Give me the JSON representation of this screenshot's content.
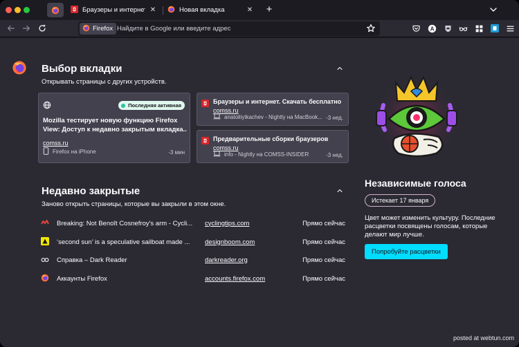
{
  "tabs": [
    {
      "title": "Браузеры и интернет. Скачать бесплатно",
      "close": "✕"
    },
    {
      "title": "Новая вкладка",
      "close": "✕"
    }
  ],
  "tabstrip": {
    "new_tab": "+"
  },
  "urlbar": {
    "identity_label": "Firefox",
    "placeholder": "Найдите в Google или введите адрес"
  },
  "toolbar": {
    "extension_badge": "A"
  },
  "tab_pickup": {
    "heading": "Выбор вкладки",
    "subheading": "Открывать страницы с других устройств.",
    "featured": {
      "badge": "Последняя активная",
      "title_line1": "Mozilla тестирует новую функцию Firefox",
      "title_line2": "View: Доступ к недавно закрытым вкладка...",
      "domain": "comss.ru",
      "device": "Firefox на iPhone",
      "time": "-3 мин"
    },
    "items": [
      {
        "title": "Браузеры и интернет. Скачать бесплатно",
        "domain": "comss.ru",
        "device": "anatoliiytkachev - Nightly на MacBook...",
        "time": "-3 нед."
      },
      {
        "title": "Предварительные сборки браузеров",
        "domain": "comss.ru",
        "device": "info - Nightly на COMSS-INSIDER",
        "time": "-3 нед."
      }
    ]
  },
  "recently_closed": {
    "heading": "Недавно закрытые",
    "subheading": "Заново открыть страницы, которые вы закрыли в этом окне.",
    "rows": [
      {
        "title": "Breaking: Not Benoît Cosnefroy's arm - Cycli...",
        "url": "cyclingtips.com",
        "time": "Прямо сейчас"
      },
      {
        "title": "‘second sun’ is a speculative sailboat made ...",
        "url": "designboom.com",
        "time": "Прямо сейчас"
      },
      {
        "title": "Справка – Dark Reader",
        "url": "darkreader.org",
        "time": "Прямо сейчас"
      },
      {
        "title": "Аккаунты Firefox",
        "url": "accounts.firefox.com",
        "time": "Прямо сейчас"
      }
    ]
  },
  "promo": {
    "title": "Независимые голоса",
    "badge": "Истекает 17 января",
    "text": "Цвет может изменить культуру. Последние расцветки посвящены голосам, которые делают мир лучше.",
    "button": "Попробуйте расцветки"
  },
  "watermark": "posted at webtun.com",
  "colors": {
    "accent": "#00ddff",
    "badge_bg": "#e0f9ee",
    "badge_dot": "#2ac3a2",
    "traffic_red": "#ff5f57",
    "traffic_yellow": "#febc2e",
    "traffic_green": "#28c840"
  },
  "icons": {
    "pinned_tab": "firefox-logo-icon",
    "tab1_favicon": "comss-icon",
    "tab2_favicon": "firefox-logo-icon",
    "toolbar": [
      "pocket-icon",
      "extension-a-icon",
      "shield-icon",
      "glasses-icon",
      "extensions-icon",
      "comss-extension-icon",
      "menu-icon"
    ]
  }
}
